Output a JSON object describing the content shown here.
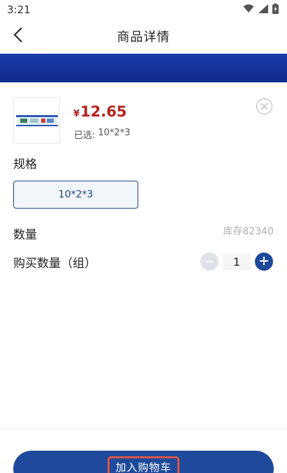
{
  "status_bar": {
    "time": "3:21",
    "icons": [
      "wifi-icon",
      "signal-icon",
      "battery-icon"
    ]
  },
  "header": {
    "title": "商品详情",
    "back_icon": "chevron-left-icon"
  },
  "banner": {
    "color": "#1636a0"
  },
  "product": {
    "currency": "¥",
    "price": "12.65",
    "selected_label": "已选:",
    "selected_value": "10*2*3"
  },
  "spec": {
    "label": "规格",
    "options": [
      "10*2*3"
    ],
    "selected": "10*2*3"
  },
  "quantity": {
    "label": "数量",
    "stock": "库存82340",
    "purchase_label": "购买数量（组）",
    "value": "1"
  },
  "actions": {
    "add_to_cart": "加入购物车"
  },
  "colors": {
    "accent": "#1f4a9b",
    "price": "#b5231f",
    "highlight_border": "#d9544a"
  }
}
